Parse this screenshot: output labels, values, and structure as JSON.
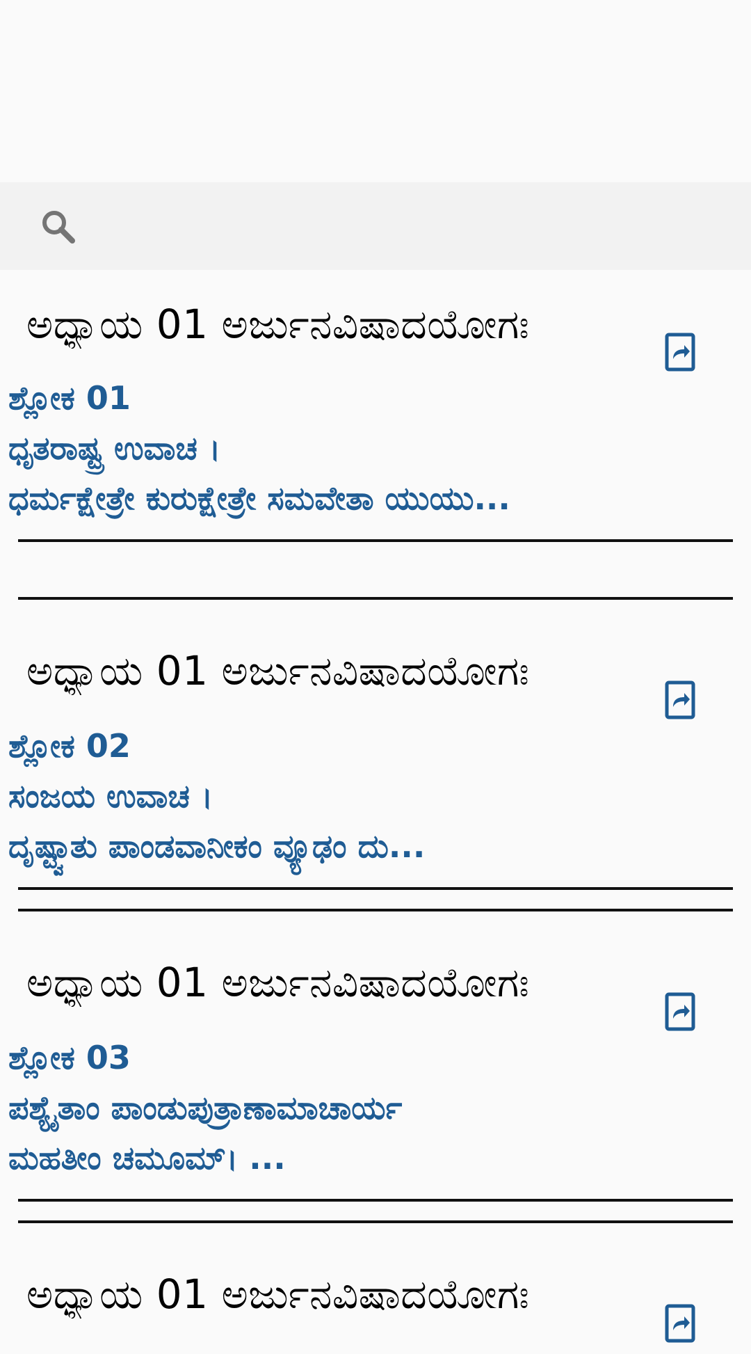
{
  "search": {
    "placeholder": ""
  },
  "cards": [
    {
      "chapter": "ಅಧ್ಯಾಯ  01 ಅರ್ಜುನವಿಷಾದಯೋಗಃ",
      "shloka": "ಶ್ಲೋಕ 01",
      "speaker": "ಧೃತರಾಷ್ಟ್ರ ಉವಾಚ ।",
      "line1": " ಧರ್ಮಕ್ಷೇತ್ರೇ ಕುರುಕ್ಷೇತ್ರೇ ಸಮವೇತಾ ಯುಯು...",
      "line2": ""
    },
    {
      "chapter": "ಅಧ್ಯಾಯ  01 ಅರ್ಜುನವಿಷಾದಯೋಗಃ",
      "shloka": "ಶ್ಲೋಕ 02",
      "speaker": "ಸಂಜಯ ಉವಾಚ ।",
      "line1": " ದೃಷ್ಟ್ವಾತು ಪಾಂಡವಾನೀಕಂ ವ್ಯೂಢಂ ದು...",
      "line2": ""
    },
    {
      "chapter": "ಅಧ್ಯಾಯ  01 ಅರ್ಜುನವಿಷಾದಯೋಗಃ",
      "shloka": "ಶ್ಲೋಕ 03",
      "speaker": "ಪಶ್ಯೈತಾಂ ಪಾಂಡುಪುತ್ರಾಣಾಮಾಚಾರ್ಯ",
      "line1": "ಮಹತೀಂ ಚಮೂಮ್। ...",
      "line2": ""
    },
    {
      "chapter": "ಅಧ್ಯಾಯ  01 ಅರ್ಜುನವಿಷಾದಯೋಗಃ"
    }
  ],
  "colors": {
    "verse_text": "#1f5c94",
    "share_icon": "#1f5c94",
    "divider": "#111111",
    "search_bar_bg": "#f2f2f2",
    "page_bg": "#fafafa"
  },
  "icons": {
    "search": "search-icon",
    "share": "share-icon"
  }
}
